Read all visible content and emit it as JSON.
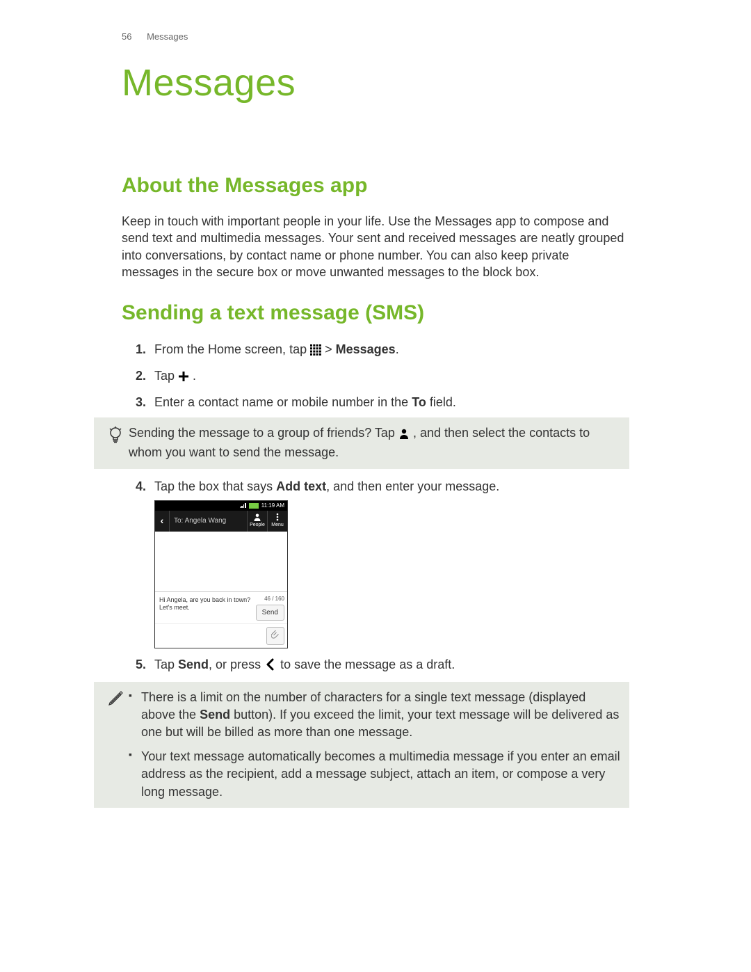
{
  "header": {
    "page_number": "56",
    "section": "Messages"
  },
  "title": "Messages",
  "section1": {
    "heading": "About the Messages app",
    "body": "Keep in touch with important people in your life. Use the Messages app to compose and send text and multimedia messages. Your sent and received messages are neatly grouped into conversations, by contact name or phone number. You can also keep private messages in the secure box or move unwanted messages to the block box."
  },
  "section2": {
    "heading": "Sending a text message (SMS)",
    "step1": {
      "a": "From the Home screen, tap ",
      "b": " > ",
      "c": "Messages",
      "d": "."
    },
    "step2": {
      "a": "Tap ",
      "b": "."
    },
    "step3": {
      "a": "Enter a contact name or mobile number in the ",
      "b": "To",
      "c": " field."
    },
    "tip": {
      "a": "Sending the message to a group of friends? Tap ",
      "b": ", and then select the contacts to whom you want to send the message."
    },
    "step4": {
      "a": "Tap the box that says ",
      "b": "Add text",
      "c": ", and then enter your message."
    },
    "step5": {
      "a": "Tap ",
      "b": "Send",
      "c": ", or press ",
      "d": " to save the message as a draft."
    },
    "note1": {
      "a": "There is a limit on the number of characters for a single text message (displayed above the ",
      "b": "Send",
      "c": " button). If you exceed the limit, your text message will be delivered as one but will be billed as more than one message."
    },
    "note2": "Your text message automatically becomes a multimedia message if you enter an email address as the recipient, add a message subject, attach an item, or compose a very long message."
  },
  "phone_mock": {
    "time": "11:19 AM",
    "to_label": "To: Angela Wang",
    "people_label": "People",
    "menu_label": "Menu",
    "draft_text": "Hi Angela, are you back in town? Let's meet.",
    "char_counter": "46 / 160",
    "send_label": "Send"
  }
}
